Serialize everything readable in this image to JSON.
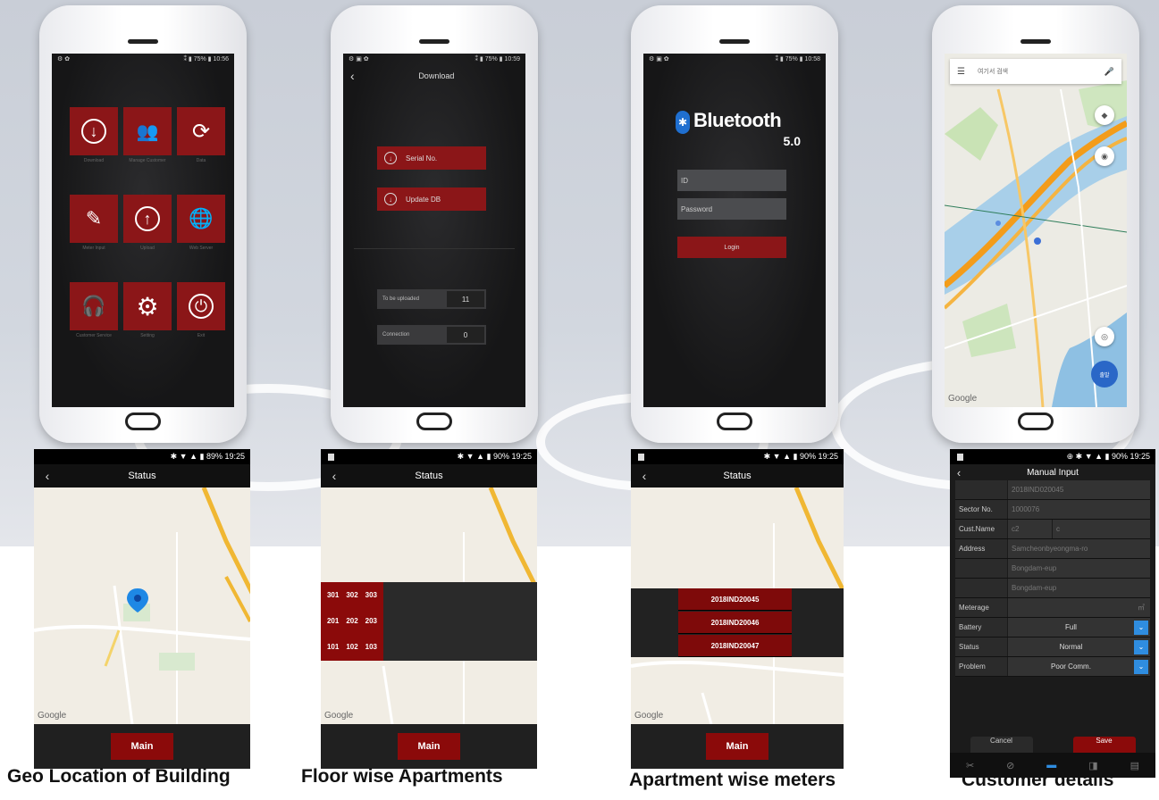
{
  "phones": {
    "menu": {
      "status": {
        "left": "⚙ ✿",
        "right": "⁑ ▮ 75% ▮ 10:56"
      },
      "tiles": [
        {
          "icon": "download-icon",
          "glyph": "↓",
          "caption": "Download"
        },
        {
          "icon": "people-add-icon",
          "glyph": "👥",
          "caption": "Manage Customer"
        },
        {
          "icon": "refresh-drop-icon",
          "glyph": "⟳",
          "caption": "Data"
        },
        {
          "icon": "edit-icon",
          "glyph": "✎",
          "caption": "Meter Input"
        },
        {
          "icon": "upload-icon",
          "glyph": "↑",
          "caption": "Upload"
        },
        {
          "icon": "globe-icon",
          "glyph": "🌐",
          "caption": "Web Server"
        },
        {
          "icon": "headset-icon",
          "glyph": "🎧",
          "caption": "Customer Service"
        },
        {
          "icon": "settings-icon",
          "glyph": "⚙",
          "caption": "Setting"
        },
        {
          "icon": "power-icon",
          "glyph": "⏻",
          "caption": "Exit"
        }
      ]
    },
    "download": {
      "status": {
        "left": "⚙ ▣ ✿",
        "right": "⁑ ▮ 75% ▮ 10:59"
      },
      "back": "‹",
      "title": "Download",
      "serial_label": "Serial No.",
      "update_label": "Update DB",
      "to_be_uploaded_label": "To be uploaded",
      "to_be_uploaded_value": "11",
      "connection_label": "Connection",
      "connection_value": "0"
    },
    "login": {
      "status": {
        "left": "⚙ ▣ ✿",
        "right": "⁑ ▮ 75% ▮ 10:58"
      },
      "brand": "Bluetooth",
      "version": "5.0",
      "id_placeholder": "ID",
      "password_placeholder": "Password",
      "login_label": "Login"
    },
    "map": {
      "search_placeholder": "여기서 검색",
      "google": "Google",
      "go_label": "출발"
    }
  },
  "shots": {
    "geo": {
      "status_right": "✱ ▼ ▲ ▮ 89% 19:25",
      "title": "Status",
      "back": "‹",
      "google": "Google",
      "main": "Main",
      "caption": "Geo Location of Building"
    },
    "floor": {
      "status_right": "✱ ▼ ▲ ▮ 90% 19:25",
      "title": "Status",
      "back": "‹",
      "google": "Google",
      "main": "Main",
      "rows": [
        [
          "301",
          "302",
          "303"
        ],
        [
          "201",
          "202",
          "203"
        ],
        [
          "101",
          "102",
          "103"
        ]
      ],
      "caption": "Floor wise Apartments"
    },
    "meters": {
      "status_right": "✱ ▼ ▲ ▮ 90% 19:25",
      "title": "Status",
      "back": "‹",
      "google": "Google",
      "main": "Main",
      "meters": [
        "2018IND20045",
        "2018IND20046",
        "2018IND20047"
      ],
      "caption": "Apartment wise meters"
    },
    "customer": {
      "status_right": "⊕ ✱ ▼ ▲ ▮ 90% 19:25",
      "title": "Manual Input",
      "back": "‹",
      "serial_value": "2018IND020045",
      "sector_label": "Sector No.",
      "sector_value": "1000076",
      "custname_label": "Cust.Name",
      "custname_value1": "c2",
      "custname_value2": "c",
      "address_label": "Address",
      "address_1": "Samcheonbyeongma-ro",
      "address_2": "Bongdam-eup",
      "address_3": "Bongdam-eup",
      "meterage_label": "Meterage",
      "meterage_unit": "㎥",
      "battery_label": "Battery",
      "battery_value": "Full",
      "status_label": "Status",
      "status_value": "Normal",
      "problem_label": "Problem",
      "problem_value": "Poor Comm.",
      "cancel_label": "Cancel",
      "save_label": "Save",
      "caption": "Customer details"
    }
  }
}
